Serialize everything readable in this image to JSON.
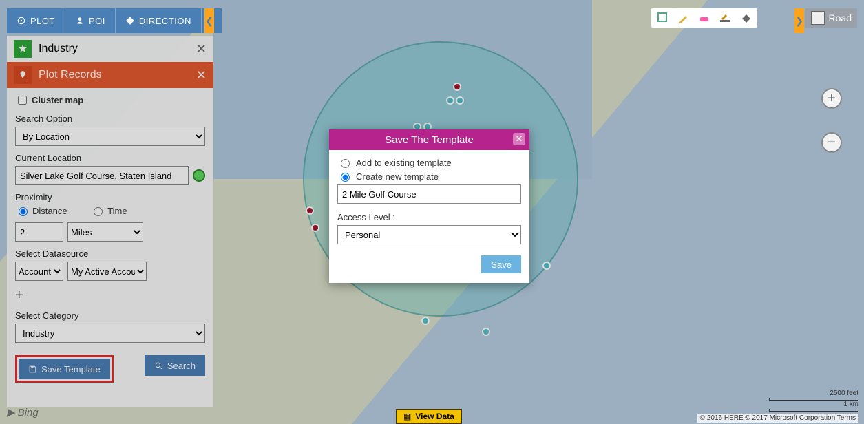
{
  "topTabs": {
    "plot": "PLOT",
    "poi": "POI",
    "direction": "DIRECTION"
  },
  "mapType": "Road",
  "industry": {
    "title": "Industry"
  },
  "plot": {
    "title": "Plot Records",
    "cluster": "Cluster map",
    "searchOptionLabel": "Search Option",
    "searchOption": "By Location",
    "currentLocationLabel": "Current Location",
    "currentLocation": "Silver Lake Golf Course, Staten Island",
    "proximityLabel": "Proximity",
    "distance": "Distance",
    "time": "Time",
    "distanceValue": "2",
    "distanceUnit": "Miles",
    "datasourceLabel": "Select Datasource",
    "datasource1": "Account",
    "datasource2": "My Active Accounts",
    "categoryLabel": "Select Category",
    "category": "Industry",
    "saveTemplate": "Save Template",
    "search": "Search"
  },
  "modal": {
    "title": "Save The Template",
    "addExisting": "Add to existing template",
    "createNew": "Create new template",
    "templateName": "2 Mile Golf Course",
    "accessLabel": "Access Level :",
    "accessLevel": "Personal",
    "save": "Save"
  },
  "footer": {
    "viewData": "View Data",
    "bing": "Bing",
    "scale1": "2500 feet",
    "scale2": "1 km",
    "attr": "© 2016 HERE © 2017 Microsoft Corporation  Terms"
  }
}
